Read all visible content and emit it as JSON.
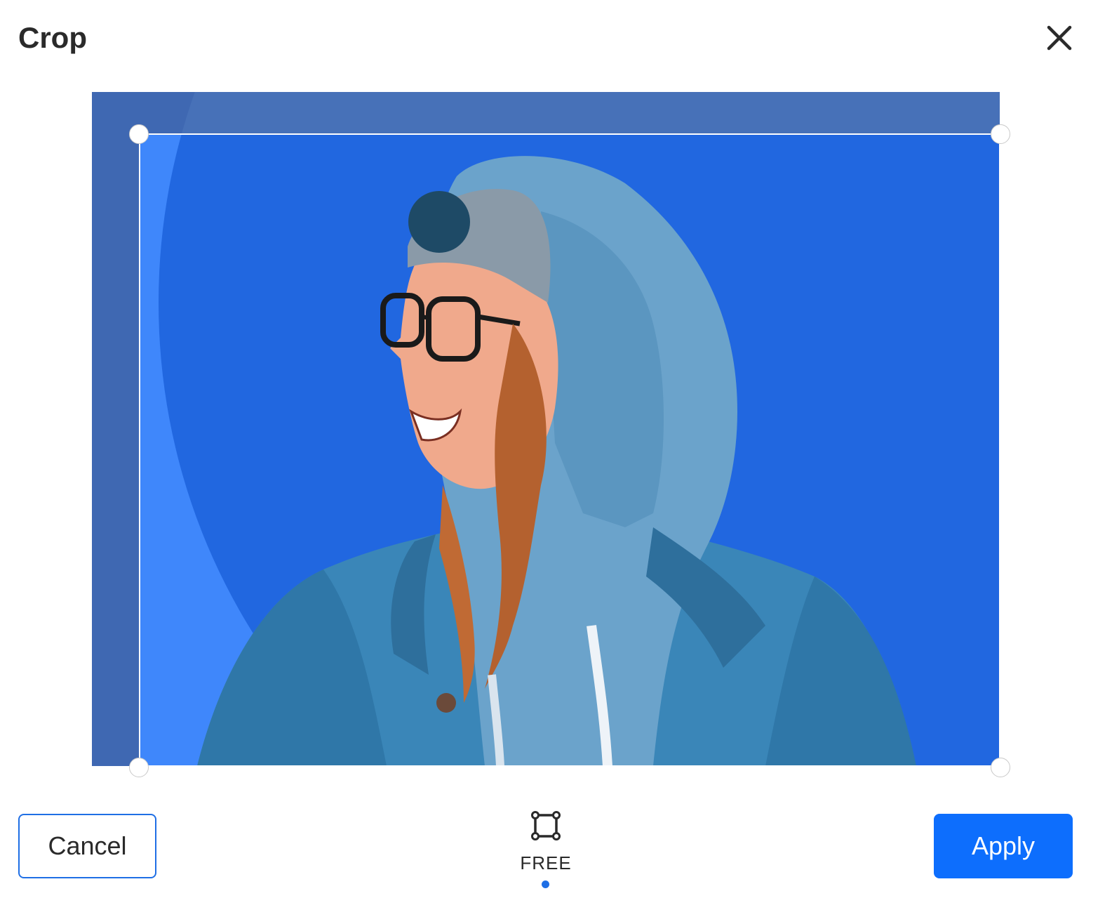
{
  "dialog": {
    "title": "Crop"
  },
  "aspect_ratio": {
    "selected_label": "FREE",
    "icon": "free-crop-icon"
  },
  "buttons": {
    "cancel_label": "Cancel",
    "apply_label": "Apply"
  },
  "icons": {
    "close": "close-icon"
  },
  "colors": {
    "accent": "#0d6efd",
    "image_background": "#2167e0",
    "image_circle": "#3f87fb",
    "dimmed_overlay": "#4a6aa3"
  }
}
